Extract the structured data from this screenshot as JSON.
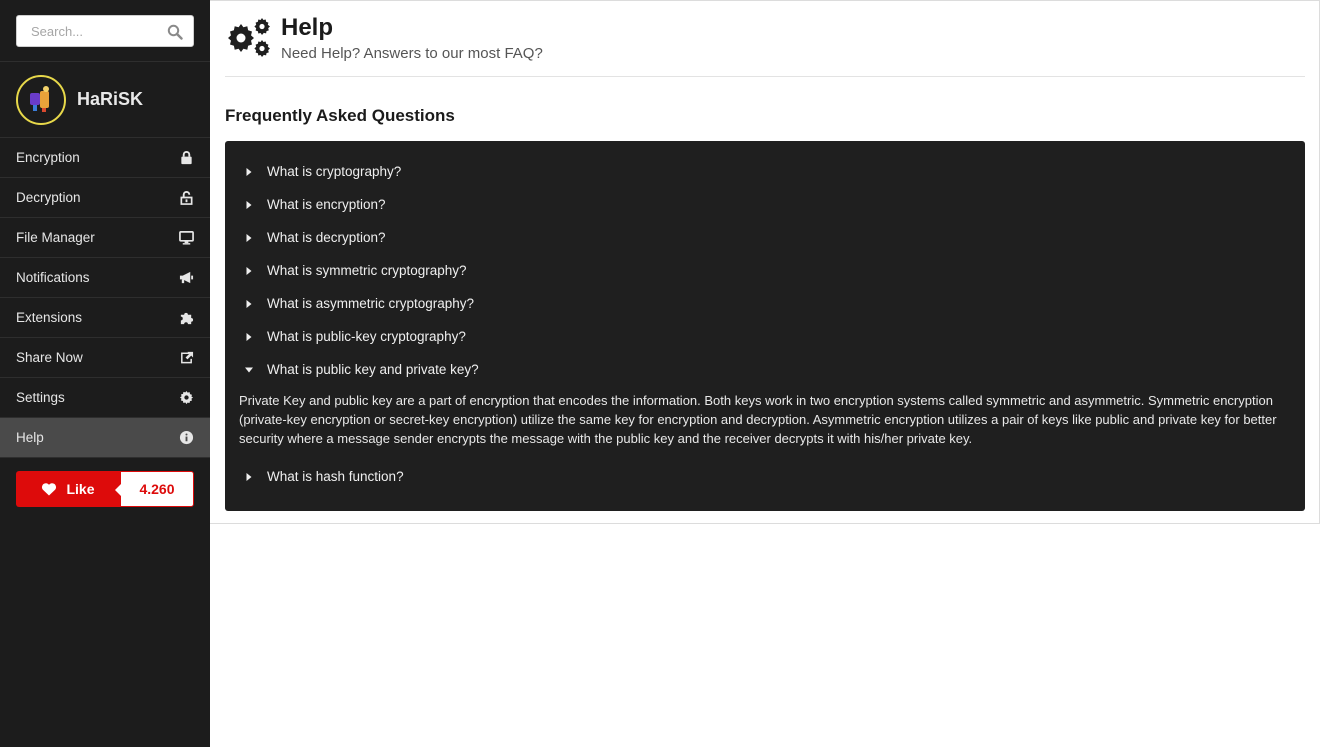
{
  "search": {
    "placeholder": "Search..."
  },
  "profile": {
    "name": "HaRiSK"
  },
  "sidebar": {
    "items": [
      {
        "label": "Encryption",
        "icon": "lock-icon"
      },
      {
        "label": "Decryption",
        "icon": "unlock-icon"
      },
      {
        "label": "File Manager",
        "icon": "monitor-icon"
      },
      {
        "label": "Notifications",
        "icon": "megaphone-icon"
      },
      {
        "label": "Extensions",
        "icon": "puzzle-icon"
      },
      {
        "label": "Share Now",
        "icon": "share-icon"
      },
      {
        "label": "Settings",
        "icon": "gear-icon"
      },
      {
        "label": "Help",
        "icon": "info-icon",
        "active": true
      }
    ]
  },
  "like": {
    "label": "Like",
    "count": "4.260",
    "color": "#dd0b0b"
  },
  "header": {
    "title": "Help",
    "subtitle": "Need Help? Answers to our most FAQ?"
  },
  "faq": {
    "title": "Frequently Asked Questions",
    "items": [
      {
        "question": "What is cryptography?",
        "expanded": false
      },
      {
        "question": "What is encryption?",
        "expanded": false
      },
      {
        "question": "What is decryption?",
        "expanded": false
      },
      {
        "question": "What is symmetric cryptography?",
        "expanded": false
      },
      {
        "question": "What is asymmetric cryptography?",
        "expanded": false
      },
      {
        "question": "What is public-key cryptography?",
        "expanded": false
      },
      {
        "question": "What is public key and private key?",
        "expanded": true,
        "answer": "Private Key and public key are a part of encryption that encodes the information. Both keys work in two encryption systems called symmetric and asymmetric. Symmetric encryption (private-key encryption or secret-key encryption) utilize the same key for encryption and decryption. Asymmetric encryption utilizes a pair of keys like public and private key for better security where a message sender encrypts the message with the public key and the receiver decrypts it with his/her private key."
      },
      {
        "question": "What is hash function?",
        "expanded": false
      }
    ]
  }
}
